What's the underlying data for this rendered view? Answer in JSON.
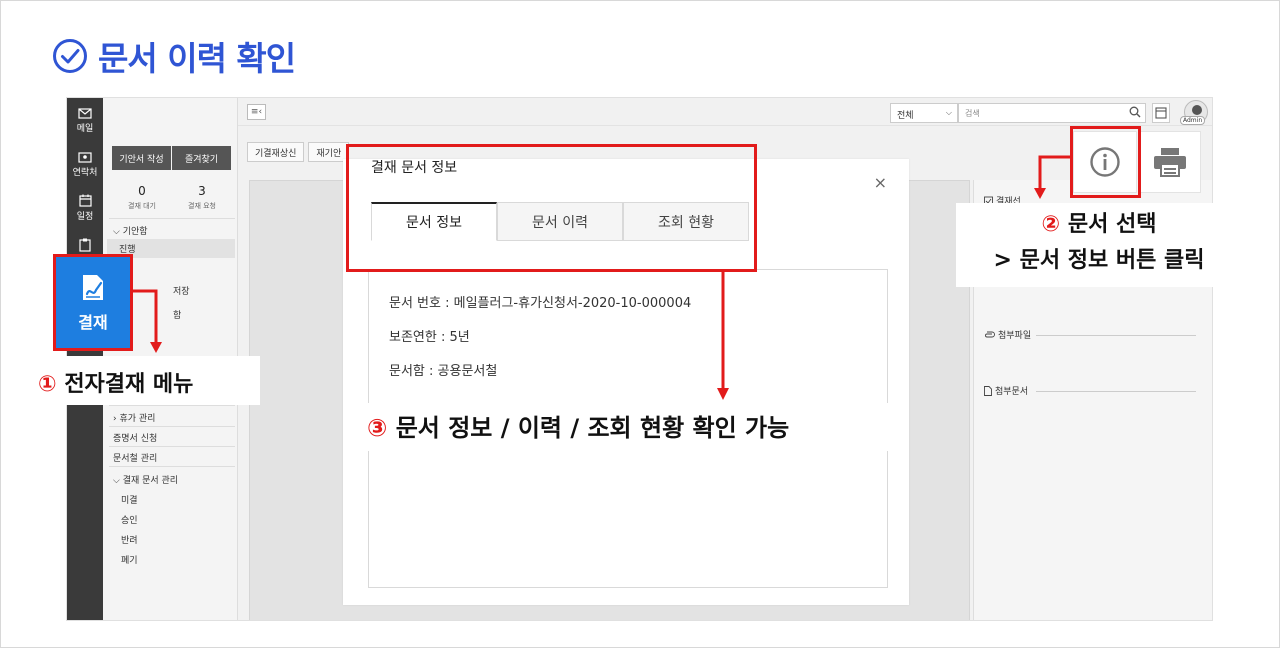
{
  "page": {
    "title": "문서 이력 확인"
  },
  "left_bar": {
    "items": [
      "메일",
      "연락처",
      "일정"
    ]
  },
  "sidebar": {
    "buttons": [
      "기안서 작성",
      "즐겨찾기"
    ],
    "counts": [
      {
        "value": "0",
        "label": "결재 대기"
      },
      {
        "value": "3",
        "label": "결재 요청"
      }
    ],
    "tree": {
      "draft_box": "기안함",
      "progress": "진행",
      "partial_1": "저장",
      "partial_2": "함",
      "leave": "휴가 관리",
      "certificate": "증명서 신청",
      "folder": "문서철 관리",
      "doc_mgmt": "결재 문서 관리",
      "sub": [
        "미결",
        "승인",
        "반려",
        "폐기"
      ]
    }
  },
  "topbar": {
    "menu_icon": "≡‹",
    "select_value": "전체",
    "search_placeholder": "검색",
    "avatar_label": "Admin"
  },
  "toolbar": {
    "buttons": [
      "기결재상신",
      "재기안"
    ]
  },
  "right_panel": {
    "items": [
      "결재선",
      "첨부파일",
      "첨부문서"
    ]
  },
  "modal": {
    "title": "결재 문서 정보",
    "close": "×",
    "tabs": [
      "문서 정보",
      "문서 이력",
      "조회 현황"
    ],
    "fields": [
      "문서 번호 : 메일플러그-휴가신청서-2020-10-000004",
      "보존연한 : 5년",
      "문서함 : 공용문서철"
    ]
  },
  "pay_menu": {
    "label": "결재"
  },
  "callouts": {
    "c1": {
      "num": "①",
      "text": "전자결재 메뉴"
    },
    "c2": {
      "num": "②",
      "line1": "문서 선택",
      "line2": "> 문서 정보 버튼 클릭"
    },
    "c3": {
      "num": "③",
      "text": "문서 정보 / 이력 / 조회 현황 확인 가능"
    }
  },
  "colors": {
    "accent": "#2f55d4",
    "highlight": "#e21b1b",
    "pay_menu": "#1e7ee0"
  }
}
